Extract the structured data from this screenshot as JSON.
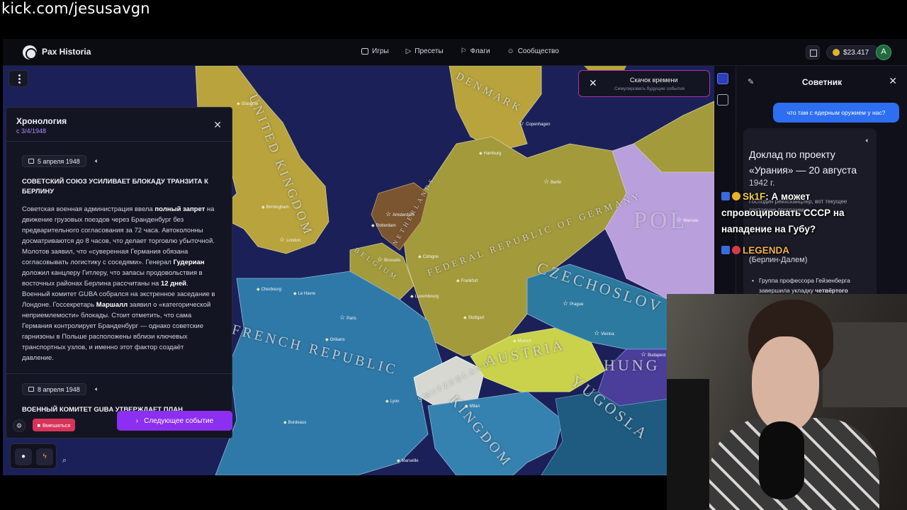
{
  "stream": {
    "url": "kick.com/jesusavgn"
  },
  "app": {
    "brand": "Pax Historia",
    "nav": [
      {
        "label": "Игры"
      },
      {
        "label": "Пресеты"
      },
      {
        "label": "Флаги"
      },
      {
        "label": "Сообщество"
      }
    ],
    "balance": "$23.417",
    "avatar_letter": "A"
  },
  "map": {
    "countries": [
      {
        "label": "DENMARK"
      },
      {
        "label": "UNITED KINGDOM"
      },
      {
        "label": "NETHERLANDS"
      },
      {
        "label": "BELGIUM"
      },
      {
        "label": "FEDERAL REPUBLIC OF GERMANY"
      },
      {
        "label": "POL"
      },
      {
        "label": "CZECHOSLOV"
      },
      {
        "label": "AUSTRIA"
      },
      {
        "label": "HUNG"
      },
      {
        "label": "SWITZERLAND"
      },
      {
        "label": "FRENCH REPUBLIC"
      },
      {
        "label": "KINGDOM"
      },
      {
        "label": "YUGOSLA"
      }
    ],
    "cities": [
      {
        "name": "Copenhagen"
      },
      {
        "name": "Hamburg"
      },
      {
        "name": "Berlin"
      },
      {
        "name": "Amsterdam"
      },
      {
        "name": "Rotterdam"
      },
      {
        "name": "Brussels"
      },
      {
        "name": "Cologne"
      },
      {
        "name": "Frankfurt"
      },
      {
        "name": "Luxembourg"
      },
      {
        "name": "Stuttgart"
      },
      {
        "name": "Munich"
      },
      {
        "name": "Prague"
      },
      {
        "name": "Vienna"
      },
      {
        "name": "Budapest"
      },
      {
        "name": "Warsaw"
      },
      {
        "name": "Paris"
      },
      {
        "name": "Le Havre"
      },
      {
        "name": "Cherbourg"
      },
      {
        "name": "Orléans"
      },
      {
        "name": "Bordeaux"
      },
      {
        "name": "Lyon"
      },
      {
        "name": "Milan"
      },
      {
        "name": "Marseille"
      },
      {
        "name": "London"
      },
      {
        "name": "Birmingham"
      },
      {
        "name": "Glasgow"
      }
    ]
  },
  "chronology": {
    "title": "Хронология",
    "subtitle": "с 3/4/1948",
    "entries": [
      {
        "date": "5 апреля 1948",
        "title": "Советский Союз усиливает блокаду транзита к Берлину",
        "body_parts": [
          "Советская военная администрация ввела ",
          "полный запрет",
          " на движение грузовых поездов через Бранденбург без предварительного согласования за 72 часа. Автоколонны досматриваются до 8 часов, что делает торговлю убыточной. Молотов заявил, что «суверенная Германия обязана согласовывать логистику с соседями». Генерал ",
          "Гудериан",
          " доложил канцлеру Гитлеру, что запасы продовольствия в восточных районах Берлина рассчитаны на ",
          "12 дней",
          ". Военный комитет GUBA собрался на экстренное заседание в Лондоне. Госсекретарь ",
          "Маршалл",
          " заявил о «категорической неприемлемости» блокады. Стоит отметить, что сама Германия контролирует Бранденбург — однако советские гарнизоны в Польше расположены вблизи ключевых транспортных узлов, и именно этот фактор создаёт давление."
        ]
      },
      {
        "date": "8 апреля 1948",
        "title": "Военный комитет GUBA утверждает план"
      }
    ],
    "next_button": "Следующее событие",
    "intervene_button": "Вмешаться"
  },
  "timejump": {
    "title": "Скачок времени",
    "subtitle": "Симулировать будущие события"
  },
  "advisor": {
    "title": "Советник",
    "user_message": "что там с ядерным оружием у нас?",
    "reply_title": "Доклад по проекту «Урания» — 20 августа",
    "reply_date": "1942 г.",
    "reply_text": "Господин рейхсканцлер, вот текущее состояние программы:",
    "reply_location": "(Берлин-Далем)",
    "reply_bullet_parts": [
      "Группа профессора Гейзенберга завершила укладку ",
      "четвёртого"
    ]
  },
  "chat": {
    "messages": [
      {
        "user": "Sk1F",
        "text": ": А может спровоцировать СССР на нападение на Губу?"
      },
      {
        "user": "LEGENDA",
        "text": ""
      }
    ]
  },
  "colors": {
    "accent_purple": "#8c2ff0",
    "intervene_red": "#d8345a",
    "user_bubble": "#2e6ef0",
    "timejump_border": "#b12ea8"
  }
}
